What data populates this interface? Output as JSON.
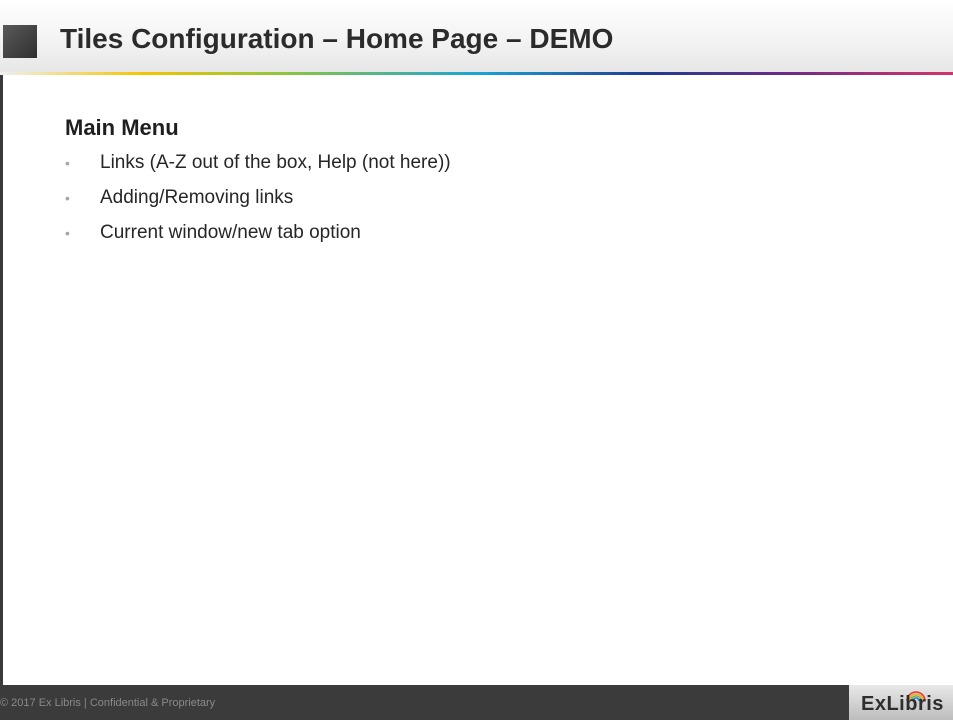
{
  "slide": {
    "title": "Tiles Configuration – Home Page – DEMO",
    "section_heading": "Main Menu",
    "bullets": [
      "Links (A-Z out of the box, Help (not here))",
      "Adding/Removing links",
      "Current window/new tab option"
    ],
    "bullet_glyph": "•"
  },
  "footer": {
    "copyright": "© 2017 Ex Libris | Confidential & Proprietary",
    "logo_text": "ExLibris"
  },
  "colors": {
    "footer_bg": "#3b3b3b",
    "title_square": "#3a3a3a",
    "title_text": "#2b2b2b",
    "bullet": "#a6a6a6"
  },
  "icons": {
    "logo_arc": "rainbow-arc-icon",
    "title_marker": "square-marker-icon"
  }
}
